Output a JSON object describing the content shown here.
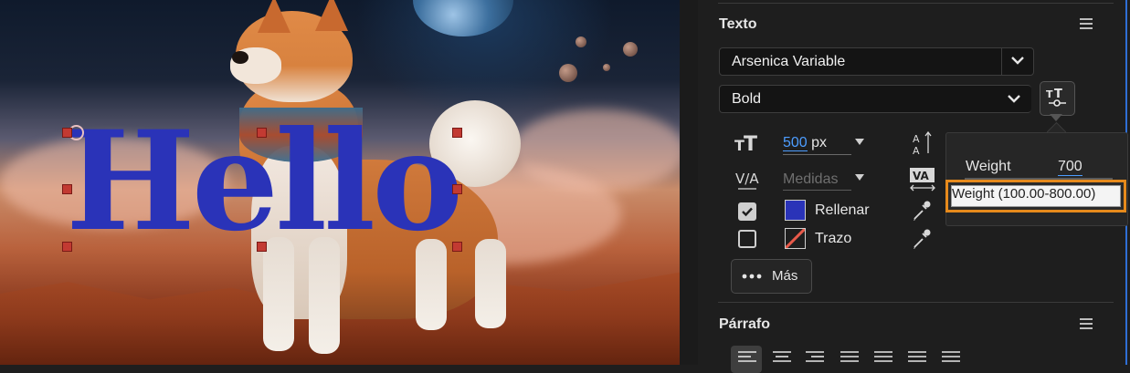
{
  "text_layer": {
    "content": "Hello"
  },
  "panel": {
    "texto": {
      "title": "Texto",
      "font_family": "Arsenica Variable",
      "font_style": "Bold",
      "font_size_value": "500",
      "font_size_unit": "px",
      "tracking_placeholder": "Medidas",
      "fill_label": "Rellenar",
      "fill_checked": true,
      "fill_color": "#2a33b8",
      "stroke_label": "Trazo",
      "stroke_checked": false,
      "more_label": "Más"
    },
    "variable_popup": {
      "axis_label": "Weight",
      "axis_value": "700",
      "tooltip": "Weight (100.00-800.00)"
    },
    "parrafo": {
      "title": "Párrafo"
    }
  },
  "icons": [
    "font-size-icon",
    "leading-icon",
    "kerning-icon",
    "tracking-icon",
    "eyedropper-icon",
    "variable-font-icon",
    "more-dots-icon",
    "menu-icon",
    "chevron-down-icon",
    "align-left-icon",
    "align-center-icon",
    "align-right-icon",
    "justify-icon"
  ],
  "colors": {
    "accent": "#2f6fd6",
    "link": "#4d9dff",
    "highlight": "#e68a1c",
    "handle": "#c23a32"
  }
}
